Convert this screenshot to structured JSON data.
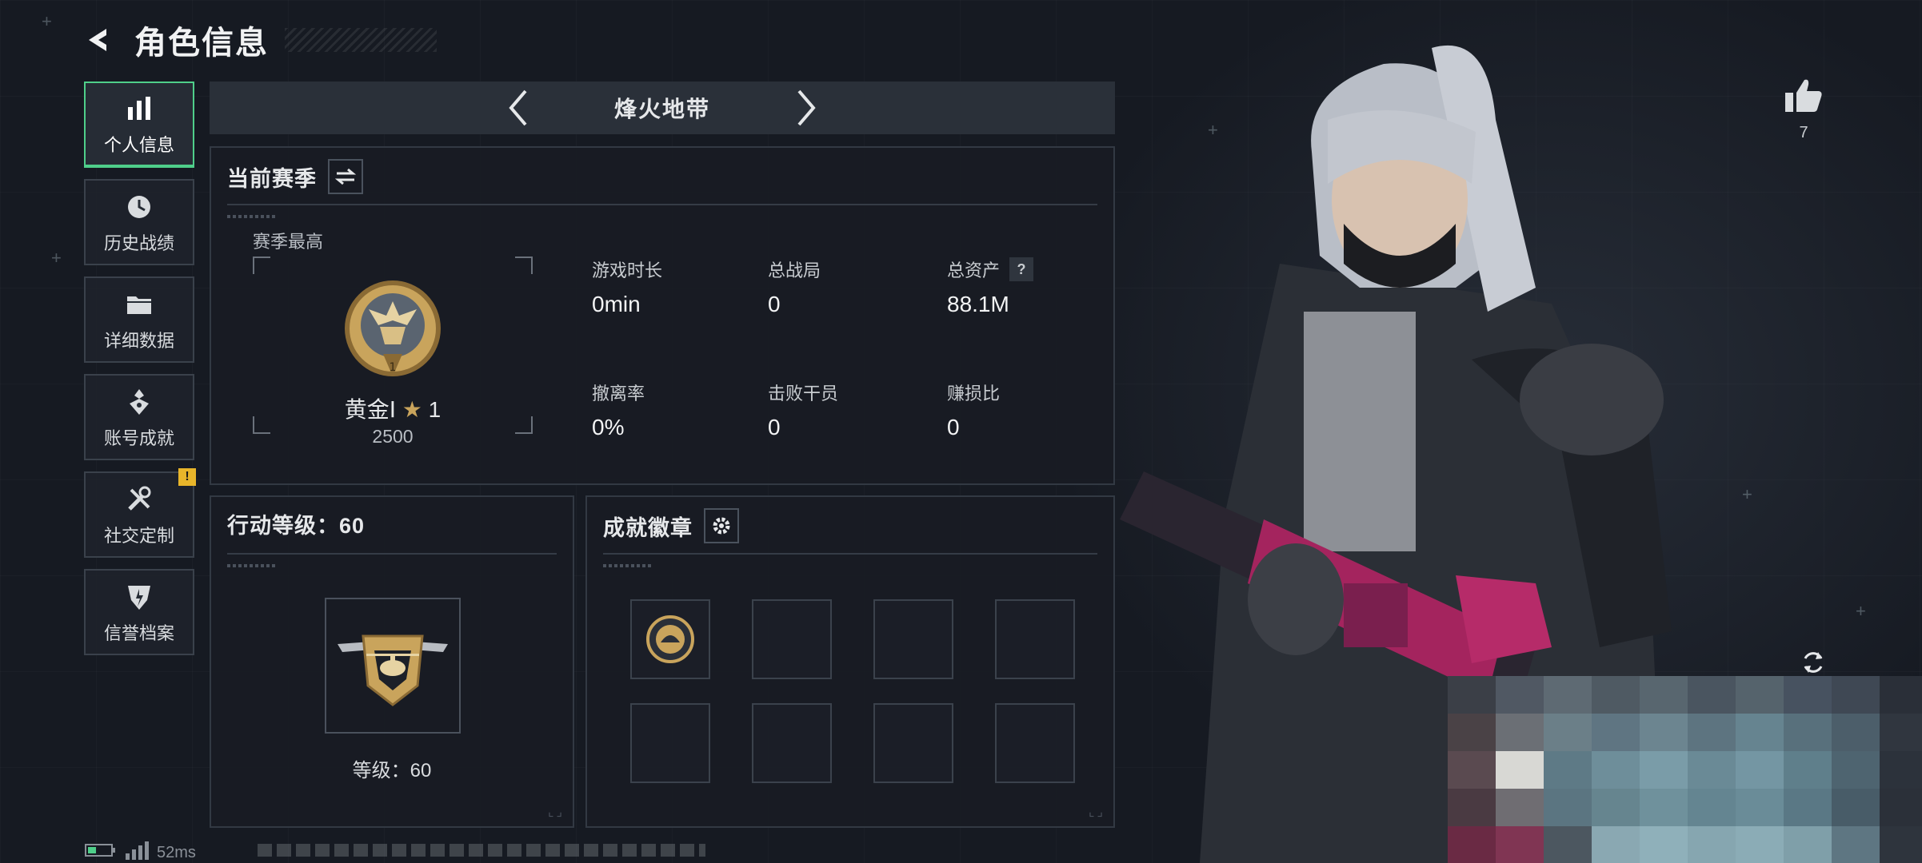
{
  "header": {
    "title": "角色信息"
  },
  "sidebar": {
    "items": [
      {
        "label": "个人信息",
        "icon": "bar-chart-icon",
        "active": true
      },
      {
        "label": "历史战绩",
        "icon": "history-icon"
      },
      {
        "label": "详细数据",
        "icon": "folder-icon"
      },
      {
        "label": "账号成就",
        "icon": "achievement-icon"
      },
      {
        "label": "社交定制",
        "icon": "tools-icon",
        "badge": "!"
      },
      {
        "label": "信誉档案",
        "icon": "credit-shield-icon"
      }
    ]
  },
  "mode": {
    "name": "烽火地带"
  },
  "season": {
    "title": "当前赛季",
    "best_label": "赛季最高",
    "rank_name": "黄金Ⅰ",
    "rank_stars": "1",
    "rank_score": "2500",
    "stats": [
      {
        "label": "游戏时长",
        "value": "0min"
      },
      {
        "label": "总战局",
        "value": "0"
      },
      {
        "label": "总资产",
        "value": "88.1M",
        "help": "?"
      },
      {
        "label": "撤离率",
        "value": "0%"
      },
      {
        "label": "击败干员",
        "value": "0"
      },
      {
        "label": "赚损比",
        "value": "0"
      }
    ]
  },
  "action_level": {
    "title": "行动等级：60",
    "level_label": "等级：60"
  },
  "achievements": {
    "title": "成就徽章"
  },
  "likes": {
    "count": "7"
  },
  "status": {
    "ping": "52ms"
  },
  "colors": {
    "accent_green": "#4fcf8a",
    "gold": "#c9a45c",
    "warning": "#e8b52a"
  }
}
